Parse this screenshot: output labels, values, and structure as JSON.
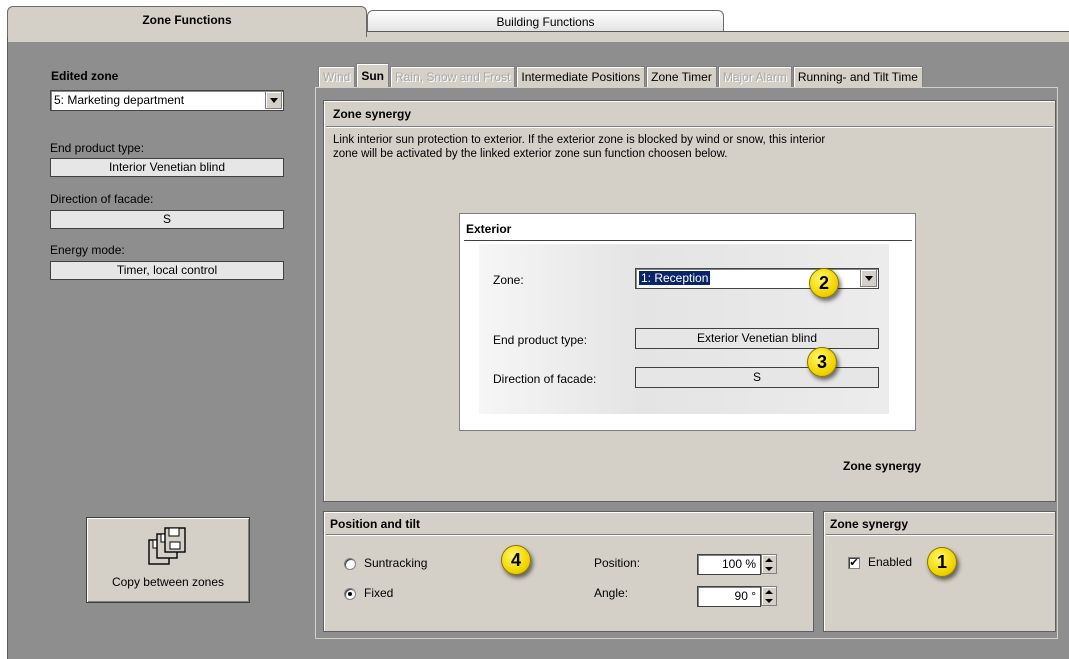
{
  "top_tabs": [
    {
      "label": "Zone Functions",
      "active": true
    },
    {
      "label": "Building Functions",
      "active": false
    }
  ],
  "left": {
    "edited_zone_label": "Edited zone",
    "edited_zone_value": "5: Marketing department",
    "end_product_label": "End product type:",
    "end_product_value": "Interior Venetian blind",
    "direction_label": "Direction of facade:",
    "direction_value": "S",
    "energy_label": "Energy mode:",
    "energy_value": "Timer, local control",
    "copy_button_label": "Copy between zones"
  },
  "function_tabs": [
    {
      "label": "Wind",
      "state": "disabled"
    },
    {
      "label": "Sun",
      "state": "active"
    },
    {
      "label": "Rain, Snow and Frost",
      "state": "disabled"
    },
    {
      "label": "Intermediate Positions",
      "state": "normal"
    },
    {
      "label": "Zone Timer",
      "state": "normal"
    },
    {
      "label": "Major Alarm",
      "state": "disabled"
    },
    {
      "label": "Running- and Tilt Time",
      "state": "normal"
    }
  ],
  "zone_synergy_panel": {
    "title": "Zone synergy",
    "description": "Link interior sun protection to exterior. If the exterior zone is blocked by wind or snow, this interior zone will be activated by the linked exterior zone sun function choosen below.",
    "footer_label": "Zone synergy",
    "exterior": {
      "title": "Exterior",
      "zone_label": "Zone:",
      "zone_value": "1: Reception",
      "end_product_label": "End product type:",
      "end_product_value": "Exterior Venetian blind",
      "direction_label": "Direction of facade:",
      "direction_value": "S"
    }
  },
  "position_tilt": {
    "title": "Position and tilt",
    "suntracking_label": "Suntracking",
    "fixed_label": "Fixed",
    "selected": "Fixed",
    "position_label": "Position:",
    "position_value": "100 %",
    "angle_label": "Angle:",
    "angle_value": "90 °"
  },
  "zone_synergy_box": {
    "title": "Zone synergy",
    "enabled_label": "Enabled",
    "enabled_checked": true
  },
  "callouts": {
    "c1": "1",
    "c2": "2",
    "c3": "3",
    "c4": "4"
  },
  "colors": {
    "callout": "#f2d600",
    "window_bg": "#d4d0c8",
    "frame_bg": "#8e8e8e",
    "selection": "#0a246a"
  }
}
